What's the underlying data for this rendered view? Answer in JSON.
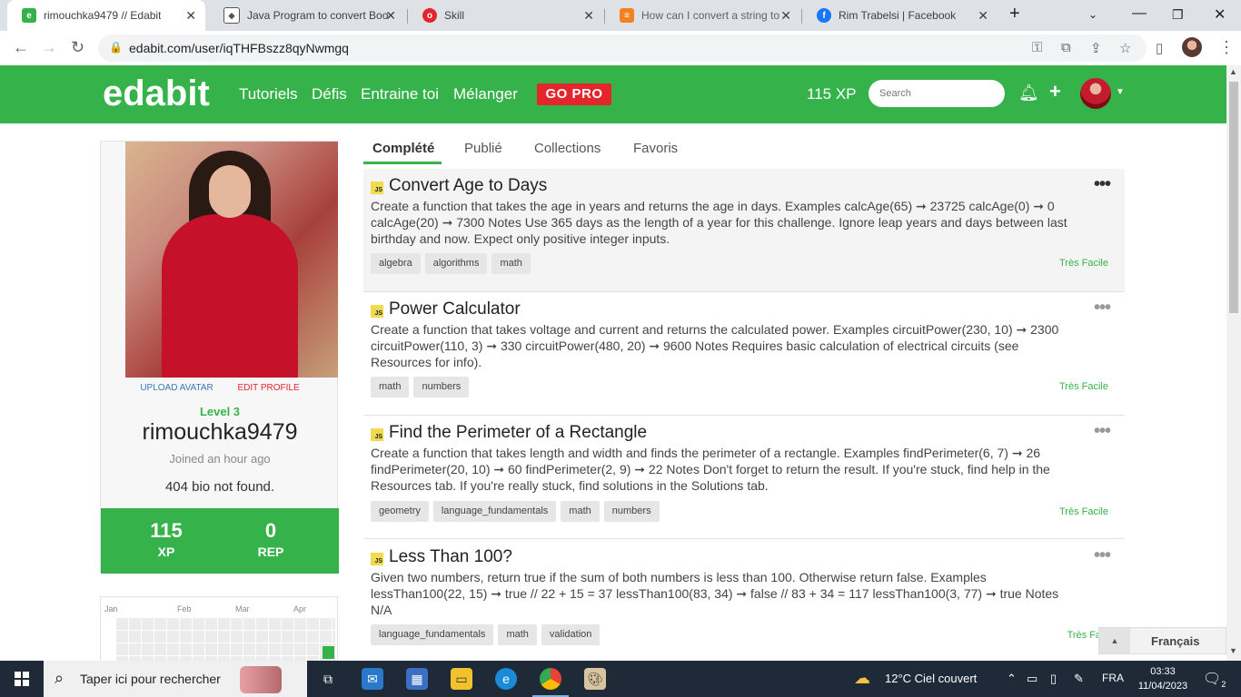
{
  "browser": {
    "tabs": [
      {
        "label": "rimouchka9479 // Edabit",
        "icon": "edabit-favicon",
        "color": "#36b24a"
      },
      {
        "label": "Java Program to convert Boo",
        "icon": "diamond-favicon",
        "color": "#555555"
      },
      {
        "label": "Skill",
        "icon": "skill-favicon",
        "color": "#e3262c"
      },
      {
        "label": "How can I convert a string to",
        "icon": "stackoverflow-favicon",
        "color": "#f48024"
      },
      {
        "label": "Rim Trabelsi | Facebook",
        "icon": "facebook-favicon",
        "color": "#1877f2"
      }
    ],
    "url": "edabit.com/user/iqTHFBszz8qyNwmgq"
  },
  "header": {
    "logo": "edabit",
    "nav": [
      "Tutoriels",
      "Défis",
      "Entraine toi",
      "Mélanger"
    ],
    "gopro": "GO PRO",
    "xp": "115 XP",
    "search_placeholder": "Search"
  },
  "profile": {
    "upload_avatar": "UPLOAD AVATAR",
    "edit_profile": "EDIT PROFILE",
    "level": "Level 3",
    "username": "rimouchka9479",
    "joined": "Joined an hour ago",
    "bio": "404 bio not found.",
    "xp_value": "115",
    "xp_label": "XP",
    "rep_value": "0",
    "rep_label": "REP",
    "months": [
      "Jan",
      "Feb",
      "Mar",
      "Apr"
    ]
  },
  "content_tabs": [
    "Complété",
    "Publié",
    "Collections",
    "Favoris"
  ],
  "challenges": [
    {
      "title": "Convert Age to Days",
      "description": "Create a function that takes the age in years and returns the age in days. Examples calcAge(65) ➞ 23725 calcAge(0) ➞ 0 calcAge(20) ➞ 7300 Notes Use 365 days as the length of a year for this challenge. Ignore leap years and days between last birthday and now. Expect only positive integer inputs.",
      "tags": [
        "algebra",
        "algorithms",
        "math"
      ],
      "difficulty": "Très Facile"
    },
    {
      "title": "Power Calculator",
      "description": "Create a function that takes voltage and current and returns the calculated power. Examples circuitPower(230, 10) ➞ 2300 circuitPower(110, 3) ➞ 330 circuitPower(480, 20) ➞ 9600 Notes Requires basic calculation of electrical circuits (see Resources for info).",
      "tags": [
        "math",
        "numbers"
      ],
      "difficulty": "Très Facile"
    },
    {
      "title": "Find the Perimeter of a Rectangle",
      "description": "Create a function that takes length and width and finds the perimeter of a rectangle. Examples findPerimeter(6, 7) ➞ 26 findPerimeter(20, 10) ➞ 60 findPerimeter(2, 9) ➞ 22 Notes Don't forget to return the result. If you're stuck, find help in the Resources tab. If you're really stuck, find solutions in the Solutions tab.",
      "tags": [
        "geometry",
        "language_fundamentals",
        "math",
        "numbers"
      ],
      "difficulty": "Très Facile"
    },
    {
      "title": "Less Than 100?",
      "description": "Given two numbers, return true if the sum of both numbers is less than 100. Otherwise return false. Examples lessThan100(22, 15) ➞ true // 22 + 15 = 37 lessThan100(83, 34) ➞ false // 83 + 34 = 117 lessThan100(3, 77) ➞ true Notes N/A",
      "tags": [
        "language_fundamentals",
        "math",
        "validation"
      ],
      "difficulty": "Très Faci"
    }
  ],
  "language_button": "Français",
  "js_badge": "JS",
  "taskbar": {
    "search_text": "Taper ici pour rechercher",
    "weather": "12°C  Ciel couvert",
    "language": "FRA",
    "time": "03:33",
    "date": "11/04/2023",
    "notifications": "2"
  }
}
